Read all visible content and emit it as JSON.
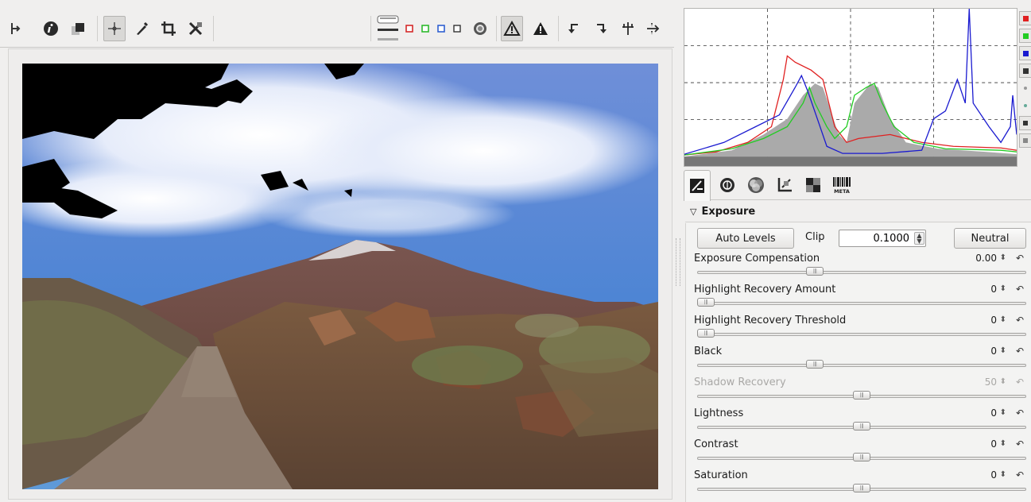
{
  "toolbar": {
    "left_icons": [
      "sidebar-toggle-icon",
      "info-icon",
      "before-after-icon",
      "hand-tool-icon",
      "color-picker-icon",
      "crop-icon",
      "straighten-icon"
    ],
    "right_icons": [
      "focus-mask-icon",
      "red-channel-icon",
      "green-channel-icon",
      "blue-channel-icon",
      "value-channel-icon",
      "luminosity-icon",
      "shadow-clip-warning-icon",
      "highlight-clip-warning-icon",
      "rotate-left-icon",
      "rotate-right-icon",
      "flip-vertical-icon",
      "flip-horizontal-icon"
    ],
    "channel_colors": {
      "red": "#d42a2a",
      "green": "#2db92d",
      "blue": "#2f5fd0"
    }
  },
  "histogram": {
    "colors": {
      "red": "#e02020",
      "green": "#22cc22",
      "blue": "#1a1ad0",
      "luma": "#a9a9a9"
    },
    "side_buttons": [
      "red-toggle-icon",
      "green-toggle-icon",
      "blue-toggle-icon",
      "luminance-toggle-icon",
      "raw-toggle-icon",
      "bar-toggle-icon",
      "mode-icon",
      "full-icon"
    ]
  },
  "tabs": [
    {
      "name": "exposure-tab-icon",
      "label": ""
    },
    {
      "name": "detail-tab-icon",
      "label": ""
    },
    {
      "name": "color-tab-icon",
      "label": ""
    },
    {
      "name": "transform-tab-icon",
      "label": ""
    },
    {
      "name": "raw-tab-icon",
      "label": ""
    },
    {
      "name": "meta-tab-icon",
      "label": "META"
    }
  ],
  "exposure": {
    "title": "Exposure",
    "auto_levels": "Auto Levels",
    "clip_label": "Clip",
    "clip_value": "0.1000",
    "neutral": "Neutral",
    "params": [
      {
        "label": "Exposure Compensation",
        "value": "0.00",
        "level": 0.35,
        "enabled": true
      },
      {
        "label": "Highlight Recovery Amount",
        "value": "0",
        "level": 0.0,
        "enabled": true
      },
      {
        "label": "Highlight Recovery Threshold",
        "value": "0",
        "level": 0.0,
        "enabled": true
      },
      {
        "label": "Black",
        "value": "0",
        "level": 0.35,
        "enabled": true
      },
      {
        "label": "Shadow Recovery",
        "value": "50",
        "level": 0.5,
        "enabled": false
      },
      {
        "label": "Lightness",
        "value": "0",
        "level": 0.5,
        "enabled": true
      },
      {
        "label": "Contrast",
        "value": "0",
        "level": 0.5,
        "enabled": true
      },
      {
        "label": "Saturation",
        "value": "0",
        "level": 0.5,
        "enabled": true
      }
    ]
  }
}
